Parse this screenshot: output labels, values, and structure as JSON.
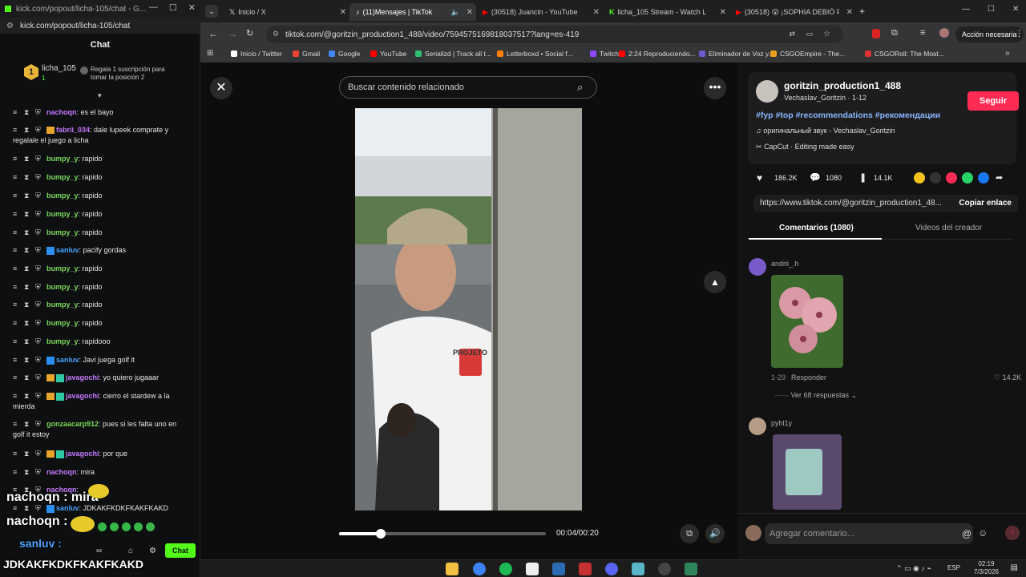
{
  "kick": {
    "window_title": "kick.com/popout/licha-105/chat - G...",
    "url": "kick.com/popout/licha-105/chat",
    "chat_title": "Chat",
    "pinned_user": "licha_105",
    "pinned_rank": "1",
    "pinned_count": "1",
    "pinned_text_1": "Regala 1 suscripción para",
    "pinned_text_2": "tomar la posición 2",
    "messages": [
      {
        "user": "nachoqn",
        "color": "p",
        "text": ": es el bayo"
      },
      {
        "user": "fabrii_034",
        "color": "p",
        "text": ": dale lupeek comprate y",
        "line2": "regalale el juego a licha"
      },
      {
        "user": "bumpy_y",
        "color": "g",
        "text": ": rapido"
      },
      {
        "user": "bumpy_y",
        "color": "g",
        "text": ": rapido"
      },
      {
        "user": "bumpy_y",
        "color": "g",
        "text": ": rapido"
      },
      {
        "user": "bumpy_y",
        "color": "g",
        "text": ": rapido"
      },
      {
        "user": "bumpy_y",
        "color": "g",
        "text": ": rapido"
      },
      {
        "user": "sanluv",
        "color": "b",
        "text": ": pacify gordas"
      },
      {
        "user": "bumpy_y",
        "color": "g",
        "text": ": rapido"
      },
      {
        "user": "bumpy_y",
        "color": "g",
        "text": ": rapido"
      },
      {
        "user": "bumpy_y",
        "color": "g",
        "text": ": rapido"
      },
      {
        "user": "bumpy_y",
        "color": "g",
        "text": ": rapido"
      },
      {
        "user": "bumpy_y",
        "color": "g",
        "text": ": rapidooo"
      },
      {
        "user": "sanluv",
        "color": "b",
        "text": ": Javi juega golf it"
      },
      {
        "user": "javagochi",
        "color": "p",
        "text": ": yo quiero jugaaar"
      },
      {
        "user": "javagochi",
        "color": "p",
        "text": ": cierro el stardew a la",
        "line2": "mierda"
      },
      {
        "user": "gonzaacarp912",
        "color": "g",
        "text": ": pues si les falta uno en",
        "line2": "golf it estoy"
      },
      {
        "user": "javagochi",
        "color": "p",
        "text": ": por que"
      },
      {
        "user": "nachoqn",
        "color": "p",
        "text": ": mira"
      },
      {
        "user": "nachoqn",
        "color": "p",
        "text": ":"
      },
      {
        "user": "sanluv",
        "color": "b",
        "text": ": JDKAKFKDKFKAKFKAKD"
      }
    ],
    "overlay_1": "nachoqn : mira",
    "overlay_2": "nachoqn :",
    "overlay_3": "sanluv :",
    "overlay_4": "JDKAKFKDKFKAKFKAKD",
    "chat_button": "Chat"
  },
  "chrome": {
    "tabs": [
      {
        "label": "Inicio / X"
      },
      {
        "label": "(11)Mensajes | TikTok"
      },
      {
        "label": "(30518) Juancin - YouTube"
      },
      {
        "label": "licha_105 Stream - Watch L"
      },
      {
        "label": "(30518) 😲 ¡SOPHIA DEBIÓ PE"
      }
    ],
    "url": "tiktok.com/@goritzin_production1_488/video/7594575169818037517?lang=es-419",
    "action_label": "Acción necesaria",
    "bookmarks": [
      {
        "label": "Inicio / Twitter",
        "color": "#ffffff"
      },
      {
        "label": "Gmail",
        "color": "#ea4335"
      },
      {
        "label": "Google",
        "color": "#4285f4"
      },
      {
        "label": "YouTube",
        "color": "#ff0000"
      },
      {
        "label": "Serializd | Track all t...",
        "color": "#2fbf71"
      },
      {
        "label": "Letterboxd • Social f...",
        "color": "#ff8000"
      },
      {
        "label": "Twitch",
        "color": "#9146ff"
      },
      {
        "label": "2:24 Reproduciendo...",
        "color": "#ff0000"
      },
      {
        "label": "Eliminador de Voz y...",
        "color": "#6a5acd"
      },
      {
        "label": "CSGOEmpire - The...",
        "color": "#f0a020"
      },
      {
        "label": "CSGORoll: The Most...",
        "color": "#d33"
      }
    ]
  },
  "tiktok": {
    "search_placeholder": "Buscar contenido relacionado",
    "time": "00:04/00:20",
    "progress": 0.2,
    "author": "goritzin_production1_488",
    "author_sub": "Vechaslav_Goritzin · 1-12",
    "follow": "Seguir",
    "hashtags": "#fyp #top #recommendations #рекомендации",
    "sound": "оригинальный звук - Vechaslav_Goritzin",
    "capcut": "CapCut · Editing made easy",
    "likes": "186.2K",
    "comments_count": "1080",
    "saves": "14.1K",
    "link": "https://www.tiktok.com/@goritzin_production1_48...",
    "copy_link": "Copiar enlace",
    "tab_comments": "Comentarios (1080)",
    "tab_creator": "Videos del creador",
    "comment1_user": "andrii_.h",
    "comment1_date": "1-29",
    "comment1_reply": "Responder",
    "comment1_likes": "14.2K",
    "comment1_more": "Ver 68 respuestas",
    "comment2_user": "pyhl1y",
    "add_comment": "Agregar comentario...",
    "shirt_text": "PROJETO"
  },
  "taskbar": {
    "lang": "ESP",
    "time": "02:19",
    "date": "7/3/2026"
  },
  "colors": {
    "kick_green": "#53fc18",
    "tiktok_red": "#fe2c55"
  }
}
